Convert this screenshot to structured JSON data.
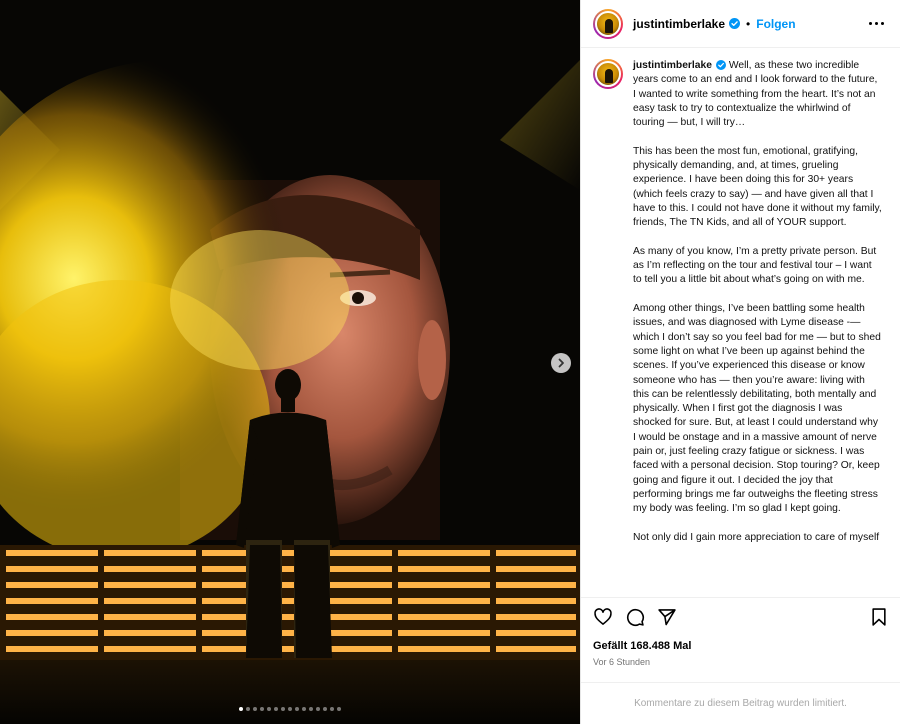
{
  "post": {
    "username": "justintimberlake",
    "follow_label": "Folgen",
    "separator": "•",
    "caption_paragraphs": [
      "Well, as these two incredible years come to an end and I look forward to the future, I wanted to write something from the heart. It’s not an easy task to try to contextualize the whirlwind of touring — but, I will try…",
      "This has been the most fun, emotional, gratifying, physically demanding, and, at times, grueling experience. I have been doing this for 30+ years (which feels crazy to say) — and have given all that I have to this. I could not have done it without my family, friends, The TN Kids, and all of YOUR support.",
      "As many of you know, I’m a pretty private person. But as I’m reflecting on the tour and festival tour – I want to tell you a little bit about what’s going on with me.",
      "Among other things, I’ve been battling some health issues, and was diagnosed with Lyme disease -— which I don’t say so you feel bad for me — but to shed some light on what I’ve been up against behind the scenes. If you’ve experienced this disease or know someone who has — then you’re aware: living with this can be relentlessly debilitating, both mentally and physically. When I first got the diagnosis I was shocked for sure. But, at least I could understand why I would be onstage and in a massive amount of nerve pain or, just feeling crazy fatigue or sickness. I was faced with a personal decision. Stop touring? Or, keep going and figure it out. I decided the joy that performing brings me far outweighs the fleeting stress my body was feeling. I’m so glad I kept going.",
      "Not only did I gain more appreciation to care of myself"
    ],
    "likes_text": "Gefällt 168.488 Mal",
    "time_text": "Vor 6 Stunden",
    "comments_limited_text": "Kommentare zu diesem Beitrag wurden limitiert.",
    "carousel": {
      "count": 15,
      "active_index": 0
    }
  },
  "icons": {
    "verified": "verified-badge-icon",
    "more": "more-options-icon",
    "like": "heart-icon",
    "comment": "comment-icon",
    "share": "send-icon",
    "save": "bookmark-icon",
    "next": "chevron-right-icon"
  },
  "colors": {
    "follow": "#0095f6",
    "verified": "#0095f6",
    "stage_yellow": "#f5c400",
    "muted_text": "#737373"
  }
}
